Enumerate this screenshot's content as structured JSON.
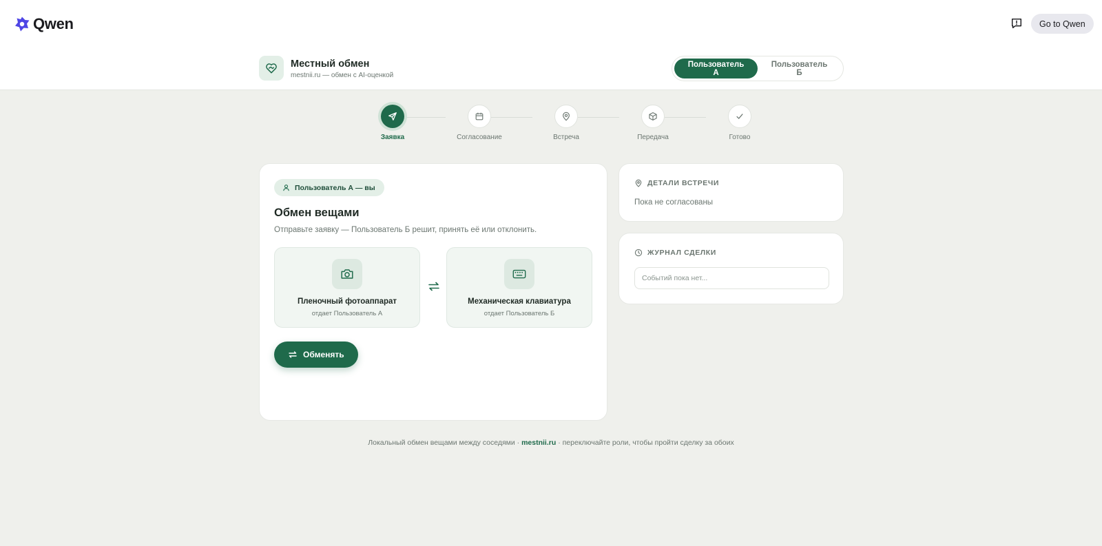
{
  "qwen": {
    "logo_text": "Qwen",
    "goto_label": "Go to Qwen"
  },
  "app": {
    "title": "Местный обмен",
    "subtitle": "mestnii.ru — обмен с AI-оценкой",
    "roles": [
      "Пользователь А",
      "Пользователь Б"
    ],
    "active_role": "Пользователь А"
  },
  "steps": [
    {
      "label": "Заявка",
      "icon": "send-icon",
      "active": true
    },
    {
      "label": "Согласование",
      "icon": "calendar-icon",
      "active": false
    },
    {
      "label": "Встреча",
      "icon": "map-pin-icon",
      "active": false
    },
    {
      "label": "Передача",
      "icon": "box-icon",
      "active": false
    },
    {
      "label": "Готово",
      "icon": "check-icon",
      "active": false
    }
  ],
  "main": {
    "badge": "Пользователь А — вы",
    "title": "Обмен вещами",
    "description": "Отправьте заявку — Пользователь Б решит, принять её или отклонить.",
    "items": [
      {
        "name": "Пленочный фотоаппарат",
        "owner": "отдает Пользователь А",
        "icon": "camera-icon"
      },
      {
        "name": "Механическая клавиатура",
        "owner": "отдает Пользователь Б",
        "icon": "keyboard-icon"
      }
    ],
    "exchange_label": "Обменять"
  },
  "meeting": {
    "heading": "ДЕТАЛИ ВСТРЕЧИ",
    "text": "Пока не согласованы"
  },
  "log": {
    "heading": "ЖУРНАЛ СДЕЛКИ",
    "placeholder": "Событий пока нет..."
  },
  "footer": {
    "before": "Локальный обмен вещами между соседями · ",
    "link": "mestnii.ru",
    "after": " · переключайте роли, чтобы пройти сделку за обоих"
  },
  "colors": {
    "accent": "#1f6a4b",
    "accent_soft": "#e3efe7",
    "background": "#eff0ec"
  }
}
